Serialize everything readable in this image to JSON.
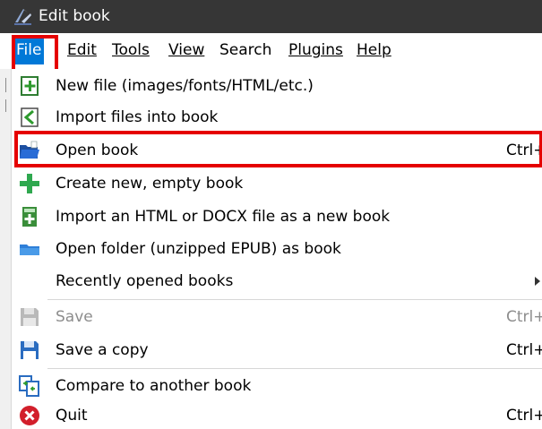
{
  "window": {
    "title": "Edit book"
  },
  "menubar": {
    "items": [
      {
        "label": "File",
        "active": true
      },
      {
        "label": "Edit",
        "active": false
      },
      {
        "label": "Tools",
        "active": false
      },
      {
        "label": "View",
        "active": false
      },
      {
        "label": "Search",
        "active": false
      },
      {
        "label": "Plugins",
        "active": false
      },
      {
        "label": "Help",
        "active": false
      }
    ]
  },
  "file_menu": {
    "items": [
      {
        "label": "New file (images/fonts/HTML/etc.)",
        "icon": "new-file-icon",
        "shortcut": ""
      },
      {
        "label": "Import files into book",
        "icon": "import-files-icon",
        "shortcut": ""
      },
      {
        "label": "Open book",
        "icon": "open-folder-icon",
        "shortcut": "Ctrl+O"
      },
      {
        "label": "Create new, empty book",
        "icon": "plus-icon",
        "shortcut": ""
      },
      {
        "label": "Import an HTML or DOCX file as a new book",
        "icon": "import-html-docx-icon",
        "shortcut": ""
      },
      {
        "label": "Open folder (unzipped EPUB) as book",
        "icon": "folder-icon",
        "shortcut": ""
      },
      {
        "label": "Recently opened books",
        "icon": "",
        "shortcut": "",
        "submenu": true
      },
      {
        "label": "Save",
        "icon": "save-icon",
        "shortcut": "Ctrl+S",
        "disabled": true
      },
      {
        "label": "Save a copy",
        "icon": "save-copy-icon",
        "shortcut": "Ctrl+Alt+S"
      },
      {
        "label": "Compare to another book",
        "icon": "compare-icon",
        "shortcut": ""
      },
      {
        "label": "Quit",
        "icon": "quit-icon",
        "shortcut": "Ctrl+Q"
      }
    ]
  },
  "colors": {
    "titlebar_bg": "#363636",
    "menu_active_bg": "#0078d7",
    "highlight_outline": "#e50000",
    "disabled_text": "#8d8d8d"
  }
}
